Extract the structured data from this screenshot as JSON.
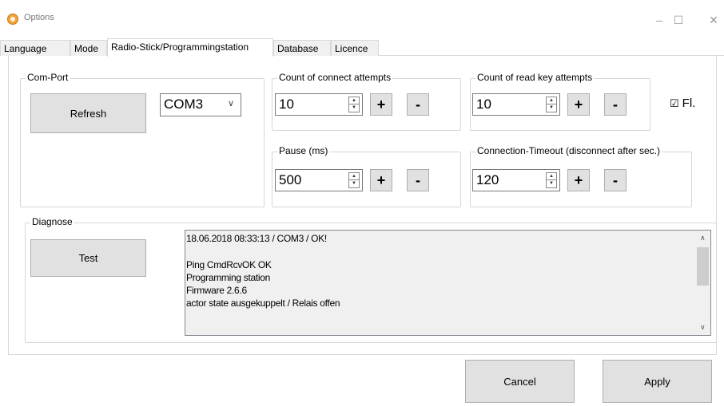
{
  "window": {
    "title": "Options",
    "app_icon": "app-logo-icon",
    "minimize_glyph": "–",
    "maximize_glyph": "☐",
    "close_glyph": "✕"
  },
  "tabs": [
    {
      "label": "Language"
    },
    {
      "label": "Mode"
    },
    {
      "label": "Radio-Stick/Programmingstation",
      "active": true
    },
    {
      "label": "Database"
    },
    {
      "label": "Licence"
    }
  ],
  "comport": {
    "legend": "Com-Port",
    "refresh_label": "Refresh",
    "selected_port": "COM3",
    "dropdown_glyph": "∨"
  },
  "connect_attempts": {
    "legend": "Count of connect attempts",
    "value": "10",
    "plus_label": "+",
    "minus_label": "-"
  },
  "read_key_attempts": {
    "legend": "Count of read key attempts",
    "value": "10",
    "plus_label": "+",
    "minus_label": "-"
  },
  "pause": {
    "legend": "Pause (ms)",
    "value": "500",
    "plus_label": "+",
    "minus_label": "-"
  },
  "connection_timeout": {
    "legend": "Connection-Timeout (disconnect after sec.)",
    "value": "120",
    "plus_label": "+",
    "minus_label": "-"
  },
  "checkbox": {
    "label": "Fl.",
    "checked": true,
    "glyph": "☑"
  },
  "spin_glyphs": {
    "up": "▲",
    "down": "▼"
  },
  "diagnose": {
    "legend": "Diagnose",
    "test_label": "Test",
    "log_lines": [
      "18.06.2018 08:33:13 / COM3 / OK!",
      "",
      "Ping CmdRcvOK OK",
      "Programming station",
      "Firmware 2.6.6",
      "actor state ausgekuppelt / Relais offen"
    ],
    "scroll_up_glyph": "∧",
    "scroll_down_glyph": "∨"
  },
  "footer": {
    "cancel_label": "Cancel",
    "apply_label": "Apply"
  }
}
